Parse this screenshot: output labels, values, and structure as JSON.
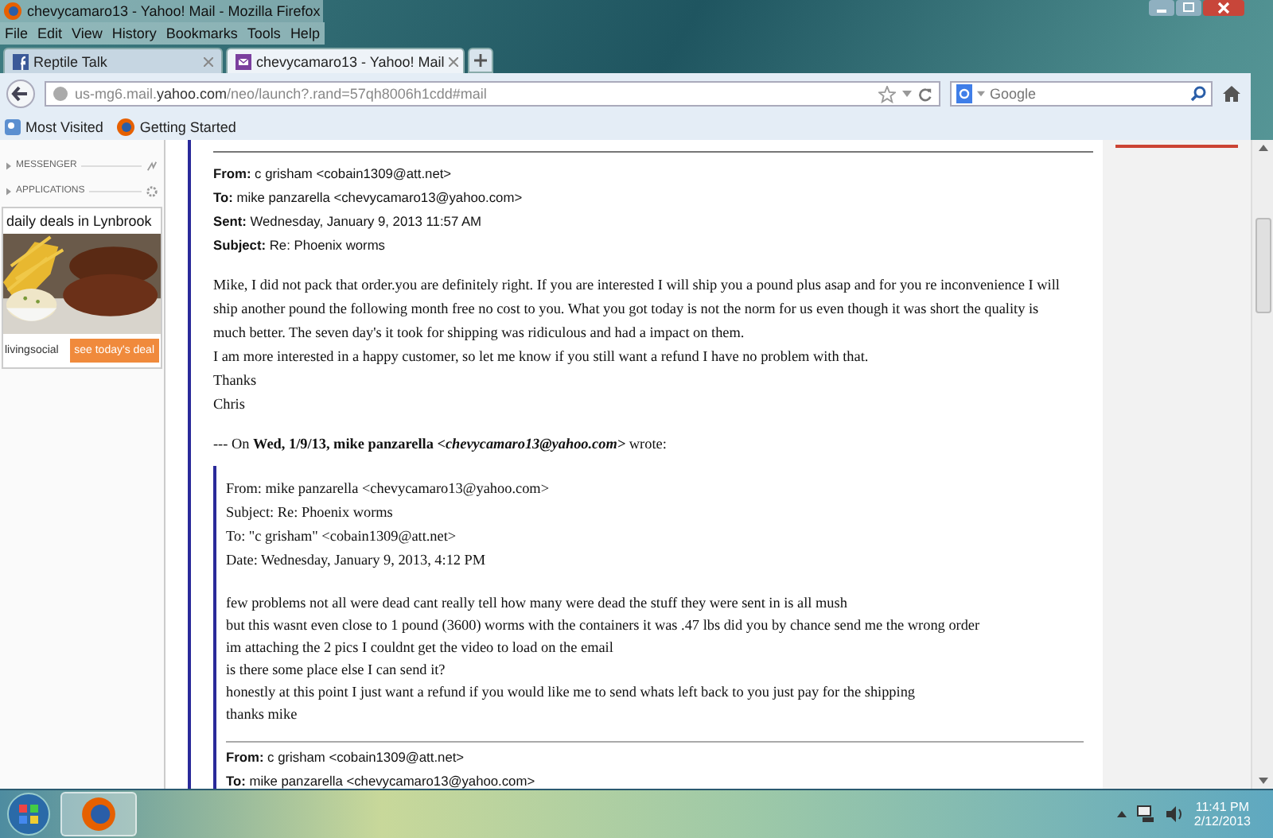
{
  "window": {
    "title": "chevycamaro13 - Yahoo! Mail - Mozilla Firefox"
  },
  "menu": [
    "File",
    "Edit",
    "View",
    "History",
    "Bookmarks",
    "Tools",
    "Help"
  ],
  "tabs": [
    {
      "label": "Reptile Talk",
      "selected": false,
      "kind": "facebook"
    },
    {
      "label": "chevycamaro13 - Yahoo! Mail",
      "selected": true,
      "kind": "mail"
    }
  ],
  "address": {
    "value": "us-mg6.mail.**yahoo.com**/neo/launch?.rand=57qh8006h1cdd#mail"
  },
  "search": {
    "placeholder": "Google"
  },
  "bookmarks": [
    {
      "label": "Most Visited",
      "kind": "visited"
    },
    {
      "label": "Getting Started",
      "kind": "firefox"
    }
  ],
  "sidebar": {
    "sections": [
      {
        "label": "MESSENGER",
        "kind": "messenger"
      },
      {
        "label": "APPLICATIONS",
        "kind": "apps"
      }
    ],
    "ad": {
      "title": "daily deals in Lynbrook",
      "brand": "livingsocial",
      "button": "see today's deal"
    }
  },
  "email": {
    "header": [
      "**From:** c grisham <cobain1309@att.net>",
      "**To:** mike panzarella <chevycamaro13@yahoo.com>",
      "**Sent:** Wednesday, January 9, 2013 11:57 AM",
      "**Subject:** Re: Phoenix worms"
    ],
    "body": [
      "Mike, I did not pack that order.you are definitely right. If you are interested I will ship you a pound plus asap and for you re inconvenience I will ship another pound the following month free no cost to you. What you got today is not the norm for us even though it was short the quality is much better. The seven day's it took for shipping was ridiculous and had a impact on them.",
      "I am more interested in a happy customer, so let me know if you still want a refund I have no problem with that.",
      "Thanks",
      "Chris"
    ],
    "wrote": "--- On **Wed, 1/9/13, mike panzarella** *<chevycamaro13@yahoo.com>* wrote:",
    "quote": {
      "header": [
        "From: mike panzarella <chevycamaro13@yahoo.com>",
        "Subject: Re: Phoenix worms",
        "To: \"c grisham\" <cobain1309@att.net>",
        "Date: Wednesday, January 9, 2013, 4:12 PM"
      ],
      "body": [
        "few problems not all were dead cant really tell how many were dead the stuff they were sent in is all mush",
        "but this wasnt even close to 1 pound (3600) worms with the containers it was .47 lbs did you by chance send me the wrong order",
        "im attaching the 2 pics I couldnt get the video to load on the email",
        "is there some place else I can send it?",
        "honestly at this point I just want a refund if you would like me to send whats left back to you just pay for the shipping",
        "thanks mike"
      ],
      "next_header": [
        "**From:** c grisham <cobain1309@att.net>",
        "**To:** mike panzarella <chevycamaro13@yahoo.com>"
      ]
    }
  },
  "taskbar": {
    "time": "11:41 PM",
    "date": "2/12/2013"
  }
}
